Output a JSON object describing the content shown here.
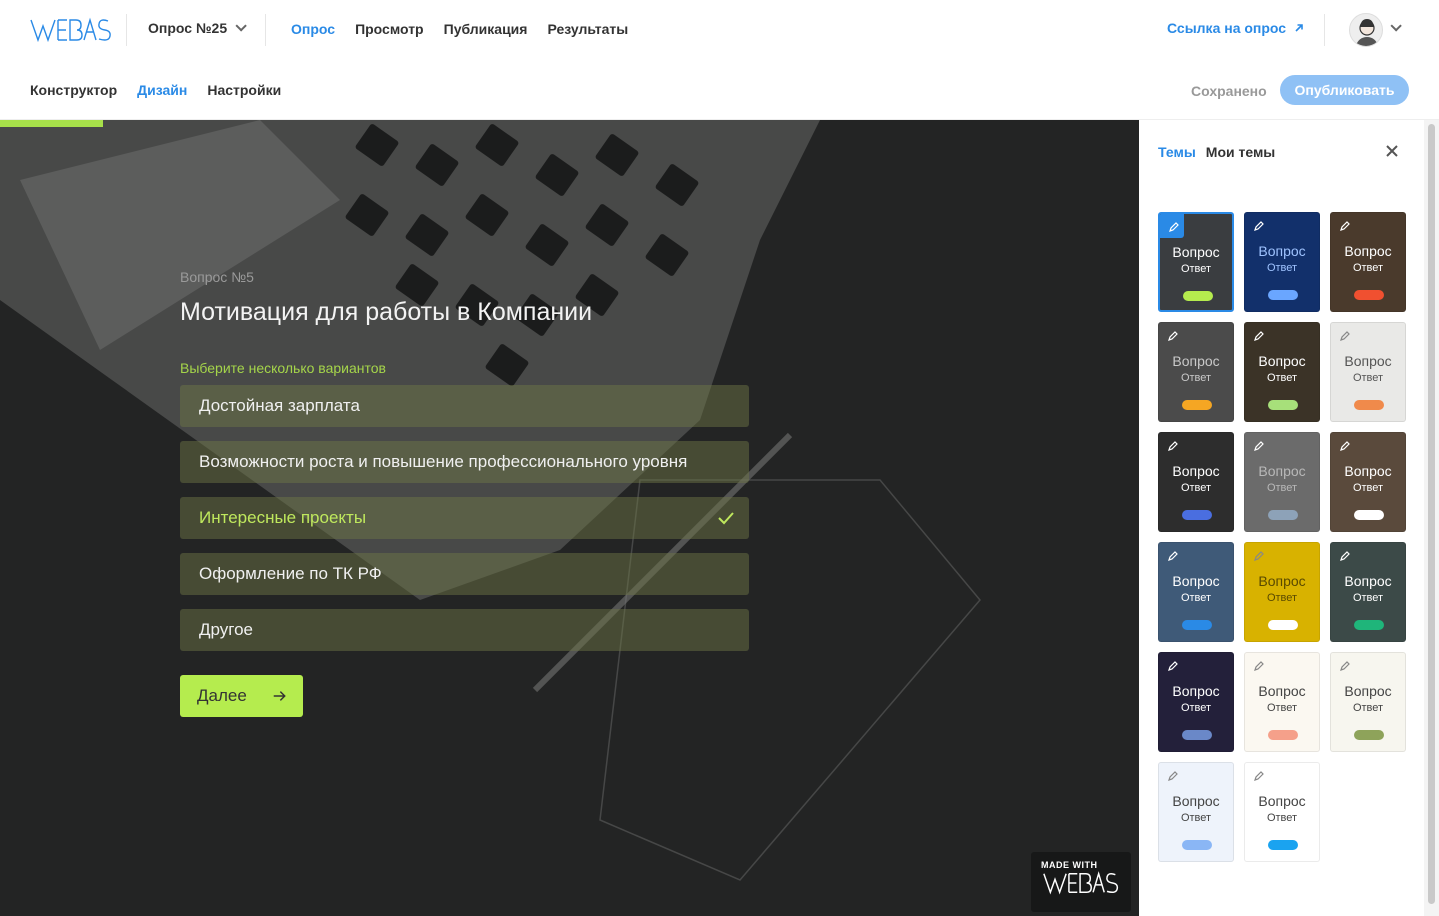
{
  "header": {
    "survey_name": "Опрос №25",
    "nav": [
      "Опрос",
      "Просмотр",
      "Публикация",
      "Результаты"
    ],
    "link_label": "Ссылка на опрос"
  },
  "subheader": {
    "tabs": [
      "Конструктор",
      "Дизайн",
      "Настройки"
    ],
    "saved_label": "Сохранено",
    "publish_label": "Опубликовать"
  },
  "question": {
    "number": "Вопрос №5",
    "title": "Мотивация для работы в Компании",
    "hint": "Выберите несколько вариантов",
    "options": [
      {
        "label": "Достойная зарплата",
        "selected": false
      },
      {
        "label": "Возможности роста и повышение профессионального уровня",
        "selected": false
      },
      {
        "label": "Интересные проекты",
        "selected": true
      },
      {
        "label": "Оформление по ТК РФ",
        "selected": false
      },
      {
        "label": "Другое",
        "selected": false
      }
    ],
    "next_label": "Далее",
    "progress": 0.09
  },
  "badge": {
    "made_with": "MADE WITH"
  },
  "panel": {
    "tabs": [
      "Темы",
      "Мои темы"
    ],
    "themes": [
      {
        "q": "Вопрос",
        "a": "Ответ",
        "bg": "#3a3d40",
        "fg": "#ffffff",
        "btn": "#b5ec4e",
        "selected": true
      },
      {
        "q": "Вопрос",
        "a": "Ответ",
        "bg": "#12306b",
        "fg": "#9fc3ff",
        "btn": "#6aa6ff",
        "selected": false
      },
      {
        "q": "Вопрос",
        "a": "Ответ",
        "bg": "#4a3a2c",
        "fg": "#ffffff",
        "btn": "#f05030",
        "selected": false
      },
      {
        "q": "Вопрос",
        "a": "Ответ",
        "bg": "#4b4b4b",
        "fg": "#c9c9c9",
        "btn": "#f5a623",
        "selected": false
      },
      {
        "q": "Вопрос",
        "a": "Ответ",
        "bg": "#3b3327",
        "fg": "#ffffff",
        "btn": "#a7e07a",
        "selected": false
      },
      {
        "q": "Вопрос",
        "a": "Ответ",
        "bg": "#e9e9e7",
        "fg": "#555555",
        "btn": "#f08a4b",
        "selected": false
      },
      {
        "q": "Вопрос",
        "a": "Ответ",
        "bg": "#2d2d2d",
        "fg": "#ffffff",
        "btn": "#4a6ee0",
        "selected": false
      },
      {
        "q": "Вопрос",
        "a": "Ответ",
        "bg": "#6b6b6b",
        "fg": "#b8b8b8",
        "btn": "#8da2b8",
        "selected": false
      },
      {
        "q": "Вопрос",
        "a": "Ответ",
        "bg": "#5a4a3c",
        "fg": "#ffffff",
        "btn": "#ffffff",
        "selected": false
      },
      {
        "q": "Вопрос",
        "a": "Ответ",
        "bg": "#3f5a78",
        "fg": "#ffffff",
        "btn": "#2a8ae6",
        "selected": false
      },
      {
        "q": "Вопрос",
        "a": "Ответ",
        "bg": "#d8b200",
        "fg": "#5a4a00",
        "btn": "#ffffff",
        "selected": false
      },
      {
        "q": "Вопрос",
        "a": "Ответ",
        "bg": "#3c4a48",
        "fg": "#ffffff",
        "btn": "#1fb57a",
        "selected": false
      },
      {
        "q": "Вопрос",
        "a": "Ответ",
        "bg": "#23203a",
        "fg": "#ffffff",
        "btn": "#6a88c8",
        "selected": false
      },
      {
        "q": "Вопрос",
        "a": "Ответ",
        "bg": "#fbf8f1",
        "fg": "#444444",
        "btn": "#f5a08a",
        "selected": false
      },
      {
        "q": "Вопрос",
        "a": "Ответ",
        "bg": "#f7f6ef",
        "fg": "#444444",
        "btn": "#8ea35a",
        "selected": false
      },
      {
        "q": "Вопрос",
        "a": "Ответ",
        "bg": "#eef3fb",
        "fg": "#444444",
        "btn": "#8ab6f5",
        "selected": false
      },
      {
        "q": "Вопрос",
        "a": "Ответ",
        "bg": "#ffffff",
        "fg": "#444444",
        "btn": "#1aa3f0",
        "selected": false
      }
    ]
  }
}
